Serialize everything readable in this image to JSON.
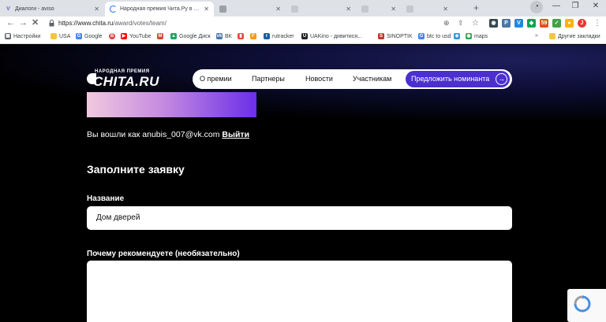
{
  "browser": {
    "tabs": [
      {
        "title": "Диалоги - aviso",
        "active": false
      },
      {
        "title": "Народная премия Чита.Ру в Чита",
        "active": true
      },
      {
        "title": "",
        "active": false
      },
      {
        "title": "",
        "active": false
      },
      {
        "title": "",
        "active": false
      },
      {
        "title": "",
        "active": false
      }
    ],
    "url_host": "https://www.chita.ru",
    "url_path": "/award/votes/team/",
    "extensions": [
      {
        "name": "vk-extension-icon",
        "color": "#4a76a8",
        "glyph": "●"
      },
      {
        "name": "badge-extension-icon",
        "color": "#e84e1b",
        "glyph": "59"
      }
    ],
    "bookmarks": [
      {
        "label": "Настройки",
        "icon": "apps-grid-icon",
        "color": "#5f6368"
      },
      {
        "label": "USA",
        "icon": "folder-icon",
        "color": "#f4c542"
      },
      {
        "label": "Google",
        "icon": "google-icon",
        "color": "#4285f4"
      },
      {
        "label": "",
        "icon": "circle-icon",
        "color": "#e04040"
      },
      {
        "label": "YouTube",
        "icon": "youtube-icon",
        "color": "#ff0000"
      },
      {
        "label": "",
        "icon": "mail-icon",
        "color": "#d14836"
      },
      {
        "label": "Google Диск",
        "icon": "google-drive-icon",
        "color": "#1fa463"
      },
      {
        "label": "ВК",
        "icon": "vk-icon",
        "color": "#4a76a8"
      },
      {
        "label": "",
        "icon": "bookmark-icon",
        "color": "#e74c3c"
      },
      {
        "label": "",
        "icon": "doc-icon",
        "color": "#f39c12"
      },
      {
        "label": "rutracker",
        "icon": "rutracker-icon",
        "color": "#1e5f9e"
      },
      {
        "label": "UAKino - дивитися...",
        "icon": "uakino-icon",
        "color": "#222"
      },
      {
        "label": "SINOPTIK",
        "icon": "sinoptik-icon",
        "color": "#c0392b"
      },
      {
        "label": "btc to usd",
        "icon": "google-icon",
        "color": "#4285f4"
      },
      {
        "label": "",
        "icon": "link-icon",
        "color": "#3498db"
      },
      {
        "label": "maps",
        "icon": "maps-icon",
        "color": "#34a853"
      }
    ],
    "other_bookmarks": "Другие закладки"
  },
  "site": {
    "logo_small": "НАРОДНАЯ ПРЕМИЯ",
    "logo_big": "CHITA.RU",
    "nav": [
      "О премии",
      "Партнеры",
      "Новости",
      "Участникам"
    ],
    "cta": "Предложить номинанта"
  },
  "auth": {
    "logged_in_text": "Вы вошли как anubis_007@vk.com",
    "logout_label": "Выйти"
  },
  "form": {
    "title": "Заполните заявку",
    "name_label": "Название",
    "name_value": "Дом дверей",
    "reason_label": "Почему рекомендуете (необязательно)",
    "reason_value": ""
  },
  "colors": {
    "accent": "#4b2fcf",
    "background": "#000000",
    "gradient_start": "#f1c9df",
    "gradient_end": "#6b2fe8"
  }
}
